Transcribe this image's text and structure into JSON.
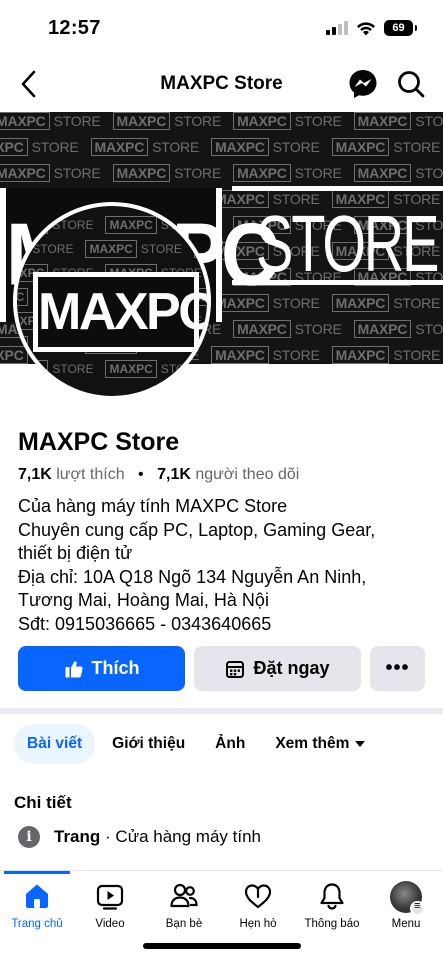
{
  "status_bar": {
    "time": "12:57",
    "battery": "69"
  },
  "nav": {
    "title": "MAXPC Store",
    "back_icon": "chevron-left-icon",
    "messenger_icon": "messenger-icon",
    "search_icon": "search-icon"
  },
  "cover": {
    "pattern_box": "MAXPC",
    "pattern_text": "STORE",
    "big_logo": "MAXPC",
    "big_store": "STORE"
  },
  "avatar": {
    "logo": "MAXPC"
  },
  "page": {
    "name": "MAXPC Store",
    "likes_count": "7,1K",
    "likes_label": "lượt thích",
    "followers_count": "7,1K",
    "followers_label": "người theo dõi",
    "bio": [
      "Của hàng máy tính MAXPC Store",
      "Chuyên cung cấp PC, Laptop, Gaming Gear,",
      "thiết bị điện tử",
      "Địa chỉ: 10A Q18 Ngõ 134 Nguyễn An Ninh,",
      "Tương Mai, Hoàng Mai, Hà Nội",
      "Sđt: 0915036665 - 0343640665"
    ]
  },
  "actions": {
    "like_label": "Thích",
    "book_label": "Đặt ngay",
    "more_label": "•••"
  },
  "tabs": [
    "Bài viết",
    "Giới thiệu",
    "Ảnh",
    "Xem thêm"
  ],
  "details": {
    "title": "Chi tiết",
    "type_label": "Trang",
    "type_value": "· Cửa hàng máy tính"
  },
  "bottom_nav": [
    "Trang chủ",
    "Video",
    "Bạn bè",
    "Hẹn hò",
    "Thông báo",
    "Menu"
  ],
  "colors": {
    "accent": "#0866ff",
    "secondary_button": "#e4e6eb",
    "muted_text": "#65676b"
  }
}
